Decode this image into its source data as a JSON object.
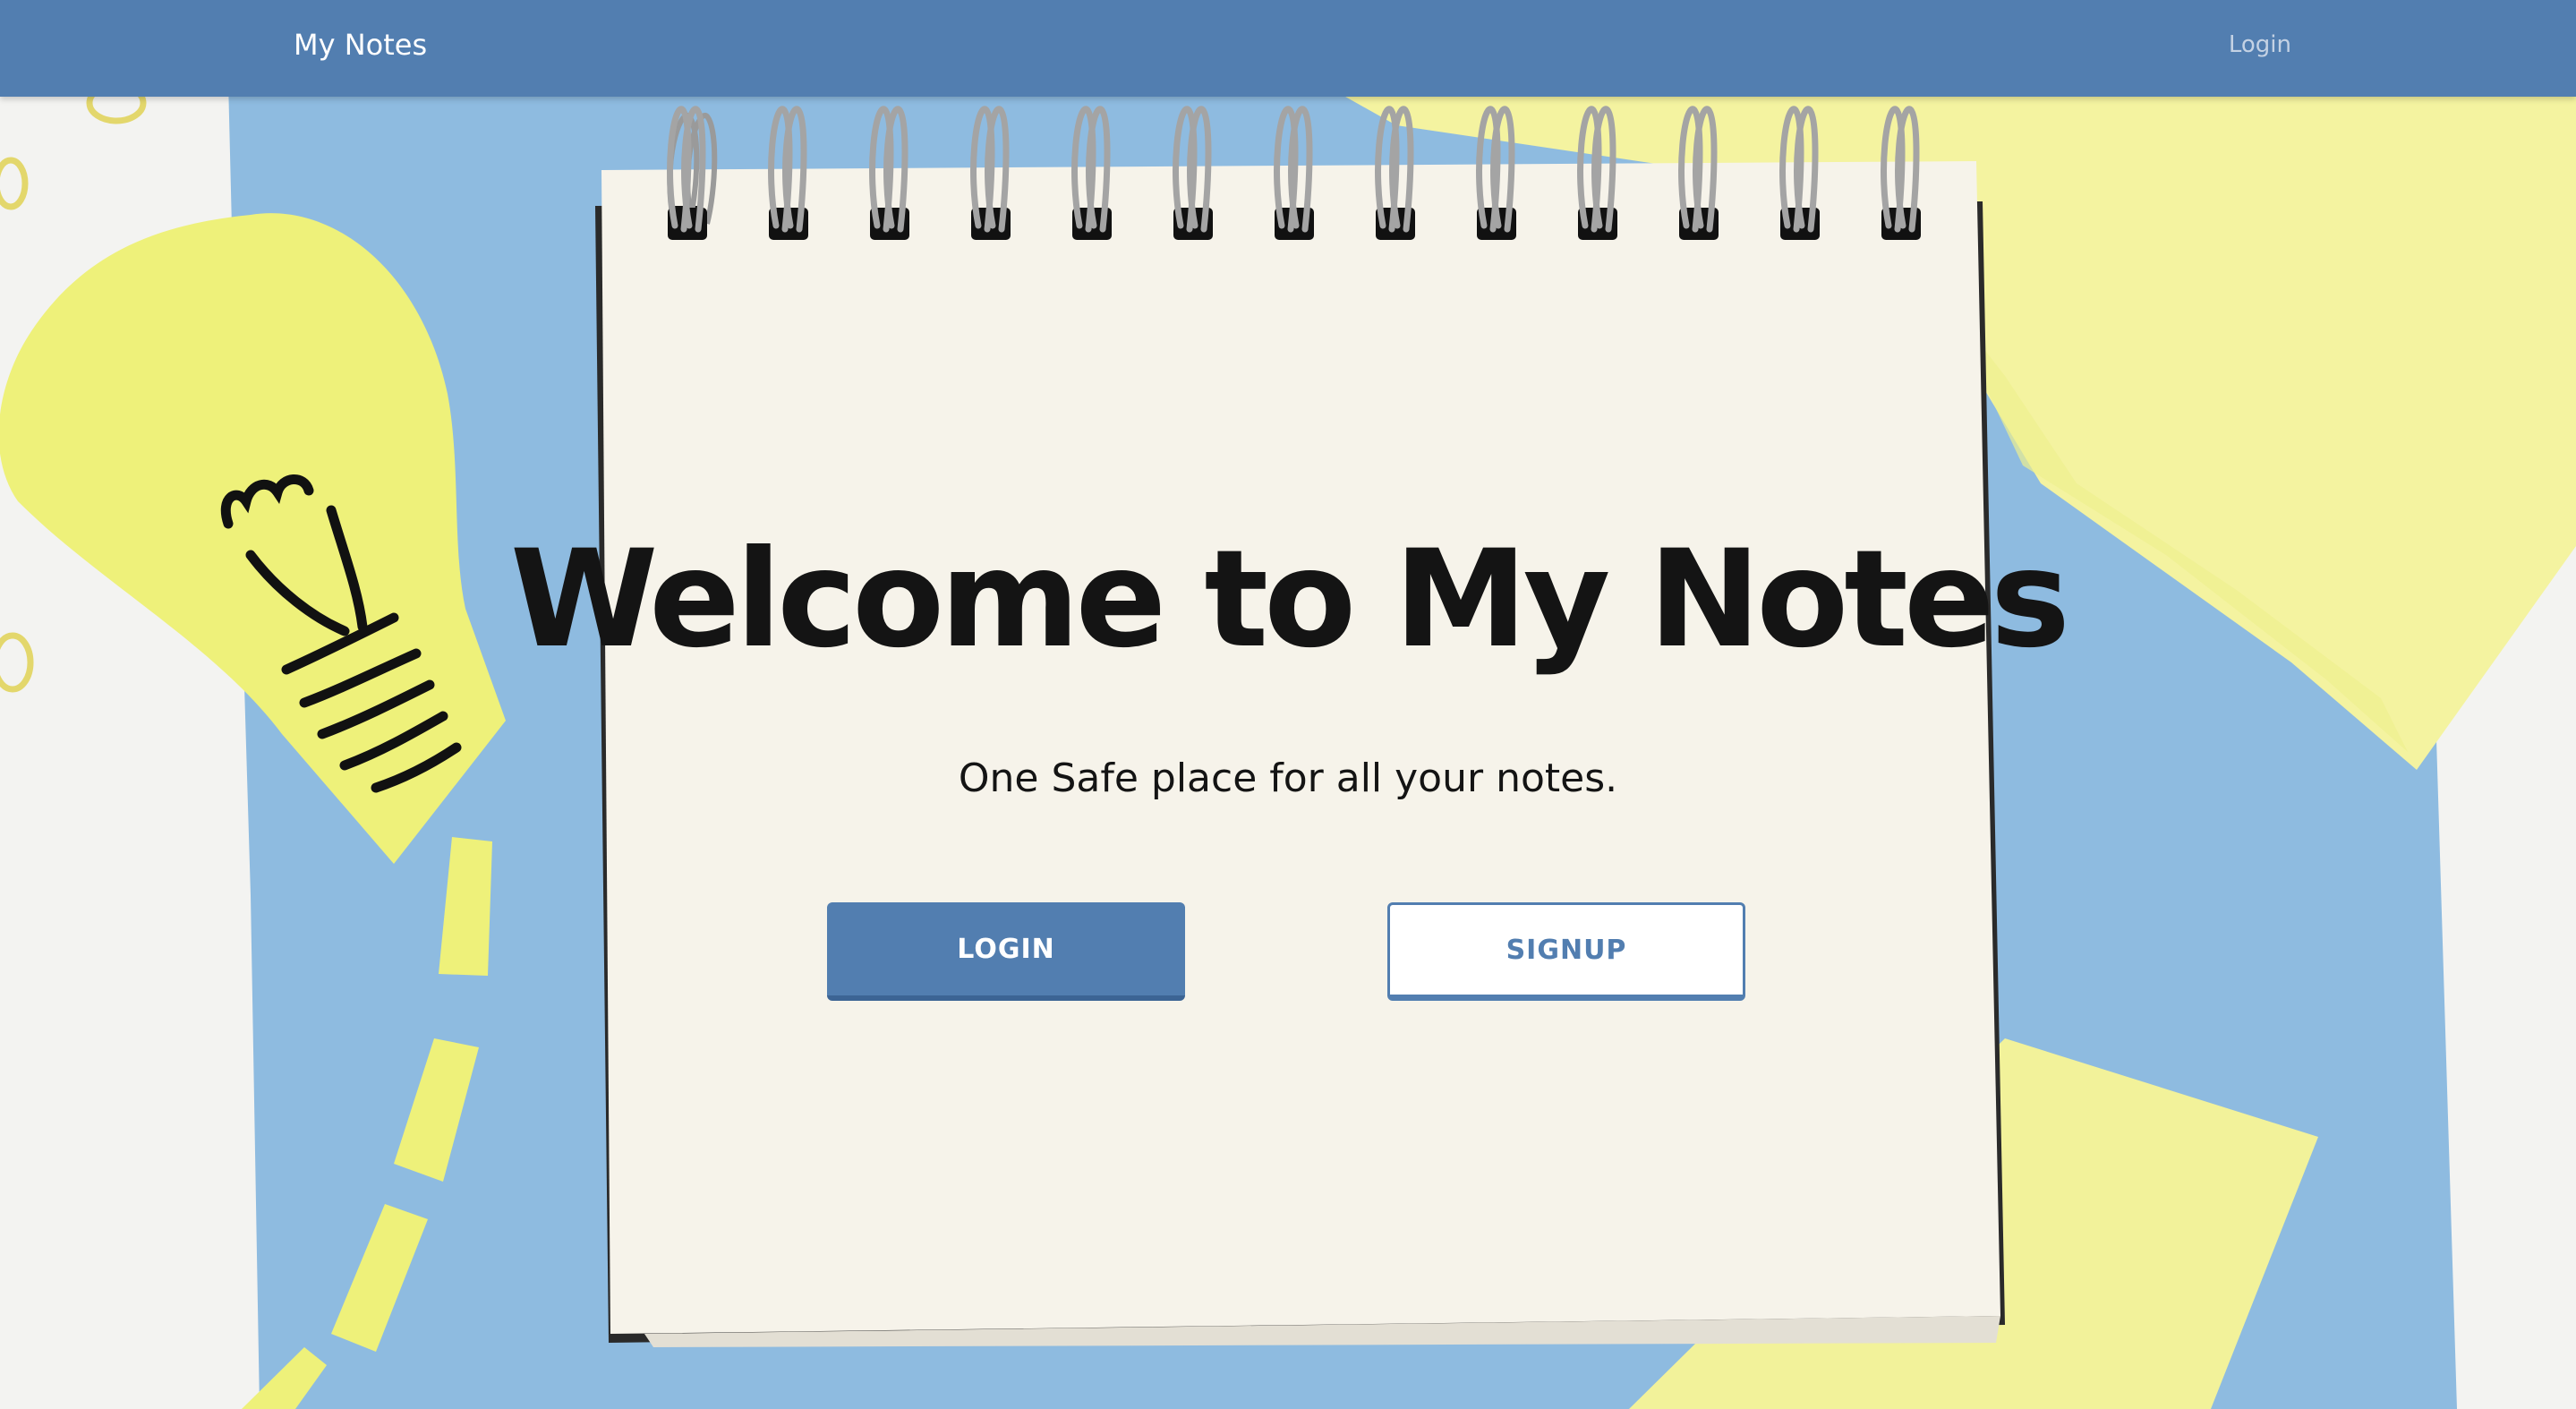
{
  "navbar": {
    "brand": "My Notes",
    "login_link": "Login"
  },
  "hero": {
    "title": "Welcome to My Notes",
    "subtitle": "One Safe place for all your notes.",
    "login_button": "LOGIN",
    "signup_button": "SIGNUP"
  },
  "colors": {
    "primary": "#527eb0",
    "paper_blue": "#8ebbe0",
    "sticky_yellow": "#f2f29a",
    "notepad": "#f6f3ea",
    "desk": "#f3f3f1",
    "text": "#141414"
  },
  "background": {
    "elements": [
      "desk-surface",
      "blue-paper",
      "yellow-sticky-notes",
      "paper-lightbulb",
      "spiral-notepad",
      "paper-clips"
    ]
  }
}
